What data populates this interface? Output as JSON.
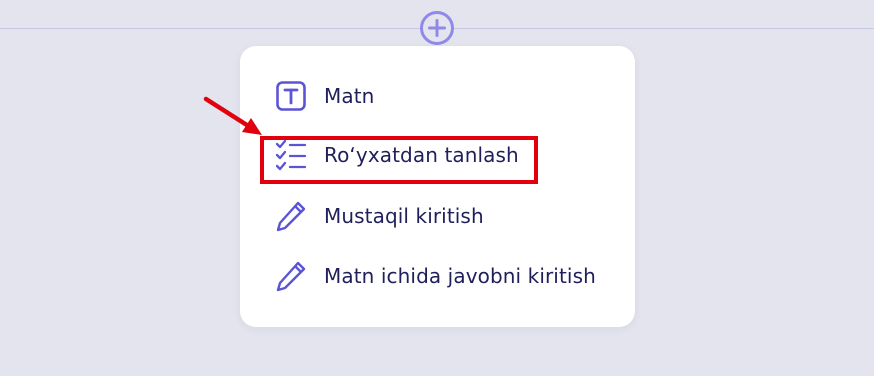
{
  "menu": {
    "items": [
      {
        "label": "Matn",
        "icon": "text-icon"
      },
      {
        "label": "Ro‘yxatdan tanlash",
        "icon": "checklist-icon"
      },
      {
        "label": "Mustaqil kiritish",
        "icon": "pencil-icon"
      },
      {
        "label": "Matn ichida javobni kiritish",
        "icon": "pencil-icon"
      }
    ]
  },
  "colors": {
    "accent": "#5b54d6",
    "add_button": "#8f8ae8",
    "highlight": "#e0000e",
    "text": "#1f1f5b",
    "background": "#e4e4ee"
  }
}
